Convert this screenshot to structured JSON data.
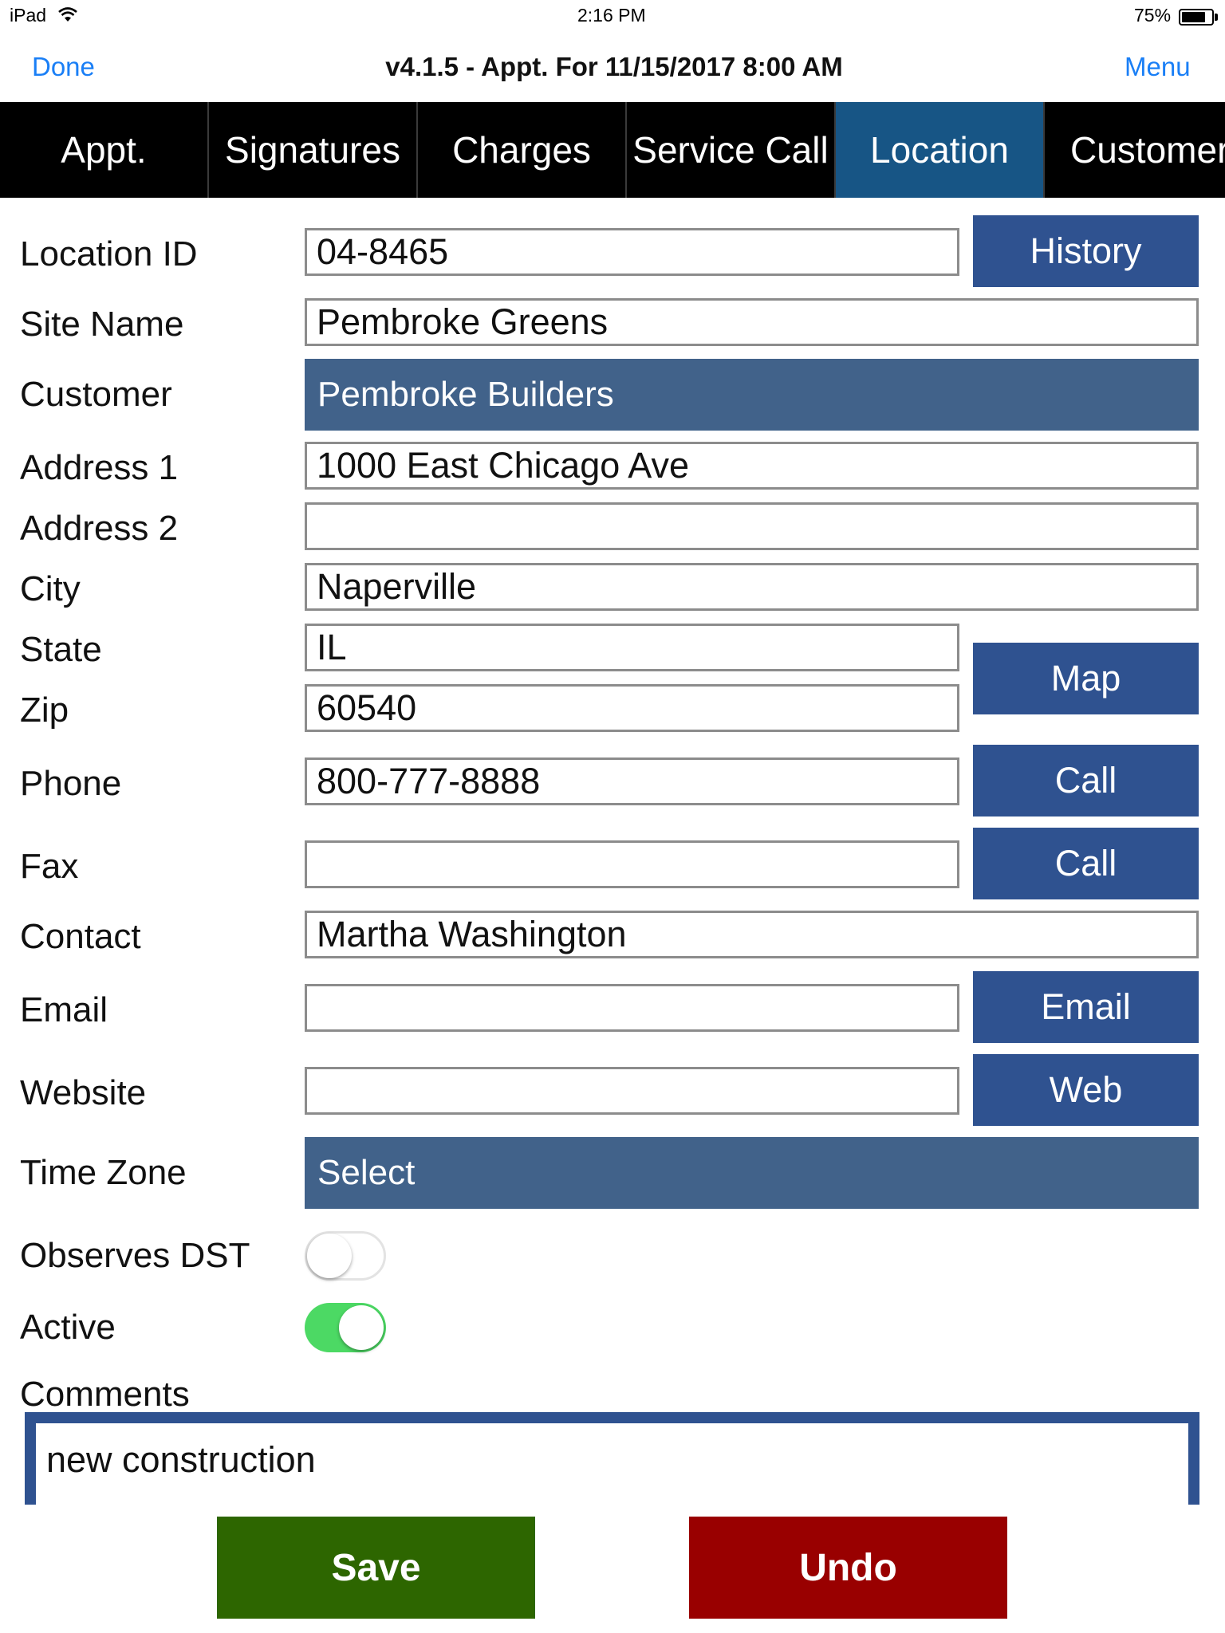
{
  "status_bar": {
    "device": "iPad",
    "time": "2:16 PM",
    "battery_percent": "75%",
    "battery_level": 0.75,
    "wifi_icon": "wifi-icon",
    "battery_icon": "battery-icon"
  },
  "nav": {
    "done_label": "Done",
    "title": "v4.1.5 - Appt. For 11/15/2017 8:00 AM",
    "menu_label": "Menu"
  },
  "tabs": [
    {
      "label": "Appt.",
      "active": false
    },
    {
      "label": "Signatures",
      "active": false
    },
    {
      "label": "Charges",
      "active": false
    },
    {
      "label": "Service Call",
      "active": false
    },
    {
      "label": "Location",
      "active": true
    },
    {
      "label": "Customer",
      "active": false
    }
  ],
  "form": {
    "location_id": {
      "label": "Location ID",
      "value": "04-8465"
    },
    "site_name": {
      "label": "Site Name",
      "value": "Pembroke Greens"
    },
    "customer": {
      "label": "Customer",
      "value": "Pembroke Builders"
    },
    "address1": {
      "label": "Address 1",
      "value": "1000 East Chicago Ave"
    },
    "address2": {
      "label": "Address 2",
      "value": ""
    },
    "city": {
      "label": "City",
      "value": "Naperville"
    },
    "state": {
      "label": "State",
      "value": "IL"
    },
    "zip": {
      "label": "Zip",
      "value": "60540"
    },
    "phone": {
      "label": "Phone",
      "value": "800-777-8888"
    },
    "fax": {
      "label": "Fax",
      "value": ""
    },
    "contact": {
      "label": "Contact",
      "value": "Martha Washington"
    },
    "email": {
      "label": "Email",
      "value": ""
    },
    "website": {
      "label": "Website",
      "value": ""
    },
    "time_zone": {
      "label": "Time Zone",
      "value": "Select"
    },
    "observes_dst": {
      "label": "Observes DST",
      "on": false
    },
    "active": {
      "label": "Active",
      "on": true
    },
    "comments": {
      "label": "Comments",
      "value": "new construction"
    }
  },
  "buttons": {
    "history": "History",
    "map": "Map",
    "call_phone": "Call",
    "call_fax": "Call",
    "email": "Email",
    "web": "Web",
    "save": "Save",
    "undo": "Undo"
  },
  "colors": {
    "accent_blue": "#1a7ff6",
    "active_tab": "#175585",
    "button_blue": "#2f5290",
    "select_blue": "#41628a",
    "switch_on": "#4cd964",
    "save_green": "#2d6600",
    "undo_red": "#990000"
  }
}
